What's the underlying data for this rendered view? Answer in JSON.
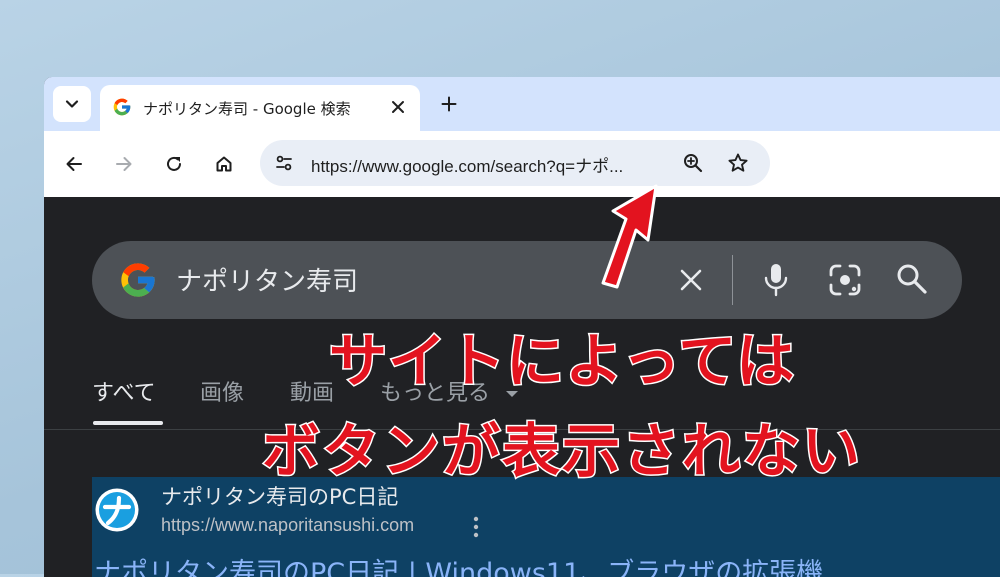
{
  "browser": {
    "tab": {
      "title": "ナポリタン寿司 - Google 検索",
      "favicon": "google-g-icon"
    },
    "toolbar": {
      "url": "https://www.google.com/search?q=ナポ...",
      "icons": [
        "back-icon",
        "forward-icon",
        "reload-icon",
        "home-icon",
        "site-info-icon",
        "zoom-icon",
        "star-icon"
      ]
    }
  },
  "search": {
    "query": "ナポリタン寿司",
    "tabs": [
      {
        "label": "すべて",
        "active": true
      },
      {
        "label": "画像"
      },
      {
        "label": "動画"
      },
      {
        "label": "もっと見る"
      }
    ]
  },
  "result": {
    "site_name": "ナポリタン寿司のPC日記",
    "site_url": "https://www.naporitansushi.com",
    "title": "ナポリタン寿司のPC日記 | Windows11、ブラウザの拡張機"
  },
  "annotation": {
    "line1": "サイトによっては",
    "line2": "ボタンが表示されない",
    "color": "#e3131f"
  },
  "colors": {
    "tabstrip": "#d3e3fd",
    "page_bg": "#202124",
    "searchbox": "#4d5156",
    "result_highlight": "#0e4164",
    "link": "#8ab4f8"
  }
}
